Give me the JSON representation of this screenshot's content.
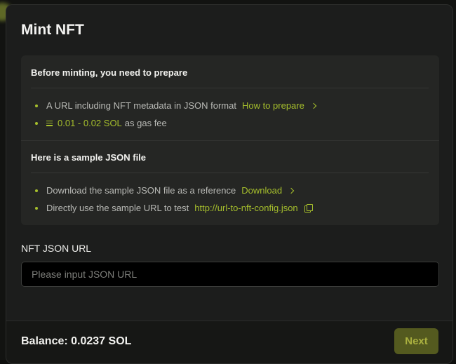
{
  "modal": {
    "title": "Mint NFT"
  },
  "prepare_section": {
    "heading": "Before minting, you need to prepare",
    "items": [
      {
        "text": "A URL including NFT metadata in JSON format",
        "link_label": "How to prepare"
      },
      {
        "amount": "0.01 - 0.02 SOL",
        "suffix": "as gas fee"
      }
    ]
  },
  "sample_section": {
    "heading": "Here is a sample JSON file",
    "items": [
      {
        "text": "Download the sample JSON file as a reference",
        "link_label": "Download"
      },
      {
        "text": "Directly use the sample URL to test",
        "link_label": "http://url-to-nft-config.json"
      }
    ]
  },
  "json_url_field": {
    "label": "NFT JSON URL",
    "value": "",
    "placeholder": "Please input JSON URL"
  },
  "footer": {
    "balance": "Balance: 0.0237 SOL",
    "next_label": "Next"
  },
  "colors": {
    "accent": "#a6bf2c",
    "modal_bg": "#1c1d1c",
    "panel_bg": "#252624",
    "next_button_bg": "#545a1f"
  },
  "icons": [
    "chevron-right-icon",
    "solana-icon",
    "copy-icon"
  ]
}
